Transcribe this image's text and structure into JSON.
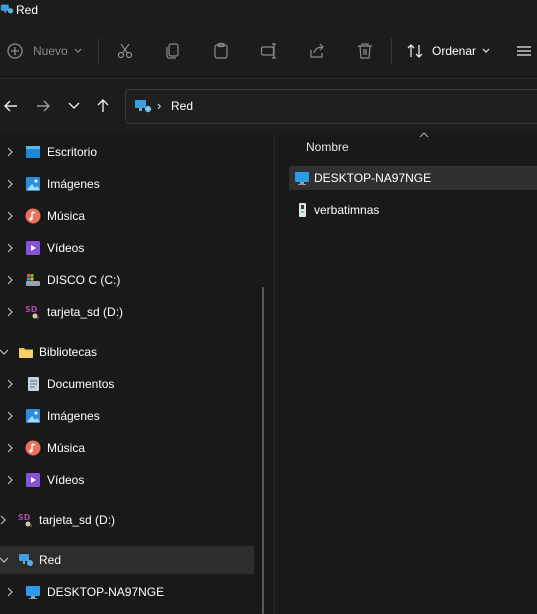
{
  "window": {
    "title": "Red"
  },
  "toolbar": {
    "new_label": "Nuevo",
    "sort_label": "Ordenar",
    "icons": [
      "cut-icon",
      "copy-icon",
      "paste-icon",
      "rename-icon",
      "share-icon",
      "delete-icon",
      "view-icon"
    ]
  },
  "address": {
    "segments": [
      "Red"
    ]
  },
  "nav": {
    "items": [
      {
        "label": "Escritorio",
        "icon": "desktop-icon"
      },
      {
        "label": "Imágenes",
        "icon": "pictures-icon"
      },
      {
        "label": "Música",
        "icon": "music-icon"
      },
      {
        "label": "Vídeos",
        "icon": "videos-icon"
      },
      {
        "label": "DISCO C (C:)",
        "icon": "drive-icon"
      },
      {
        "label": "tarjeta_sd (D:)",
        "icon": "sd-card-icon"
      },
      {
        "label": "Bibliotecas",
        "icon": "folder-icon"
      },
      {
        "label": "Documentos",
        "icon": "documents-icon"
      },
      {
        "label": "Imágenes",
        "icon": "pictures-icon"
      },
      {
        "label": "Música",
        "icon": "music-icon"
      },
      {
        "label": "Vídeos",
        "icon": "videos-icon"
      },
      {
        "label": "tarjeta_sd (D:)",
        "icon": "sd-card-icon"
      },
      {
        "label": "Red",
        "icon": "network-icon"
      },
      {
        "label": "DESKTOP-NA97NGE",
        "icon": "computer-icon"
      }
    ]
  },
  "content": {
    "column_header": "Nombre",
    "files": [
      {
        "name": "DESKTOP-NA97NGE",
        "icon": "computer-icon"
      },
      {
        "name": "verbatimnas",
        "icon": "nas-device-icon"
      }
    ]
  }
}
